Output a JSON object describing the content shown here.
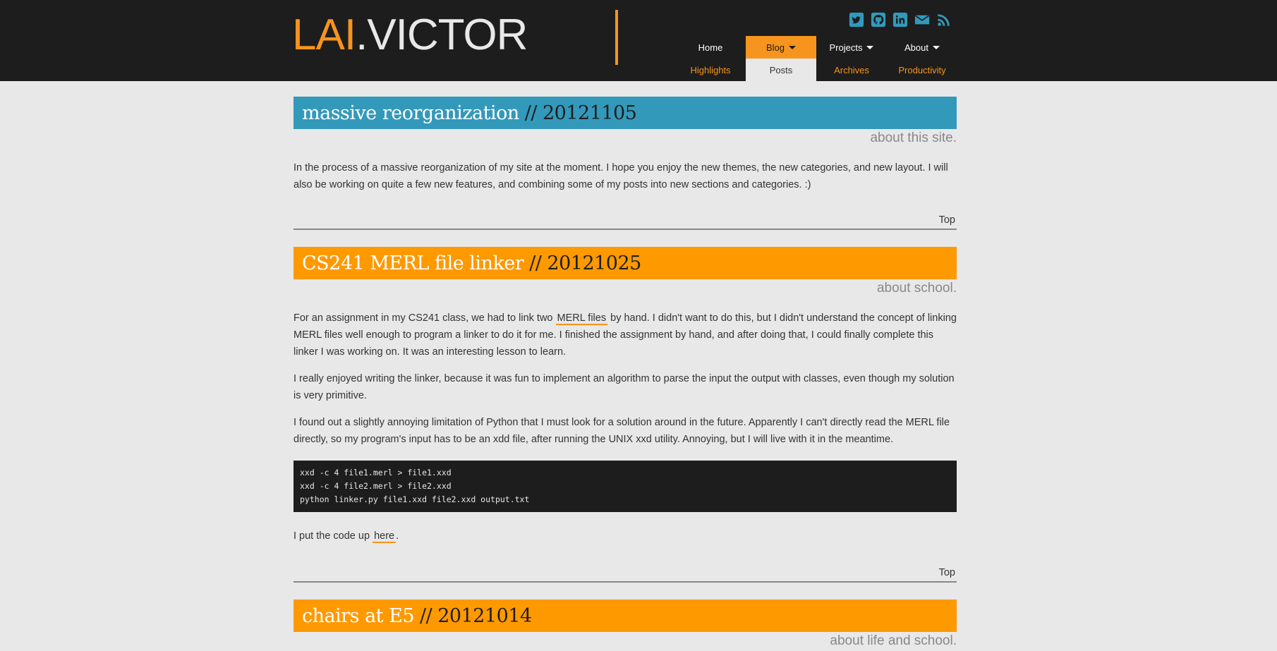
{
  "site": {
    "logo_first": "LAI",
    "logo_dot": ".",
    "logo_last": "VICTOR"
  },
  "social": [
    "twitter-icon",
    "github-icon",
    "linkedin-icon",
    "mail-icon",
    "rss-icon"
  ],
  "nav": {
    "items": [
      {
        "label": "Home",
        "has_caret": false,
        "active": false
      },
      {
        "label": "Blog",
        "has_caret": true,
        "active": true
      },
      {
        "label": "Projects",
        "has_caret": true,
        "active": false
      },
      {
        "label": "About",
        "has_caret": true,
        "active": false
      }
    ],
    "sub_items": [
      {
        "label": "Highlights",
        "active": false
      },
      {
        "label": "Posts",
        "active": true
      },
      {
        "label": "Archives",
        "active": false
      },
      {
        "label": "Productivity",
        "active": false
      }
    ]
  },
  "colors": {
    "accent_orange": "#ff9900",
    "accent_blue": "#3399bb",
    "header_bg": "#1d1d1d",
    "page_bg": "#e8e8e8"
  },
  "posts": [
    {
      "title": "massive reorganization",
      "separator": "//",
      "date": "20121105",
      "category": "about this site.",
      "paragraph_1": "In the process of a massive reorganization of my site at the moment. I hope you enjoy the new themes, the new categories, and new layout. I will also be working on quite a few new features, and combining some of my posts into new sections and categories. :)",
      "top_link": "Top"
    },
    {
      "title": "CS241 MERL file linker",
      "separator": "//",
      "date": "20121025",
      "category": "about school.",
      "paragraph_1_before": "For an assignment in my CS241 class, we had to link two",
      "paragraph_1_link": "MERL files",
      "paragraph_1_after": "by hand. I didn't want to do this, but I didn't understand the concept of linking MERL files well enough to program a linker to do it for me. I finished the assignment by hand, and after doing that, I could finally complete this linker I was working on. It was an interesting lesson to learn.",
      "paragraph_2": "I really enjoyed writing the linker, because it was fun to implement an algorithm to parse the input the output with classes, even though my solution is very primitive.",
      "paragraph_3": "I found out a slightly annoying limitation of Python that I must look for a solution around in the future. Apparently I can't directly read the MERL file directly, so my program's input has to be an xdd file, after running the UNIX xxd utility. Annoying, but I will live with it in the meantime.",
      "code_lines": [
        "xxd -c 4 file1.merl > file1.xxd",
        "xxd -c 4 file2.merl > file2.xxd",
        "python linker.py file1.xxd file2.xxd output.txt"
      ],
      "paragraph_4_before": "I put the code up",
      "paragraph_4_link": "here",
      "paragraph_4_after": ".",
      "top_link": "Top"
    },
    {
      "title": "chairs at E5",
      "separator": "//",
      "date": "20121014",
      "category": "about life and school."
    }
  ]
}
